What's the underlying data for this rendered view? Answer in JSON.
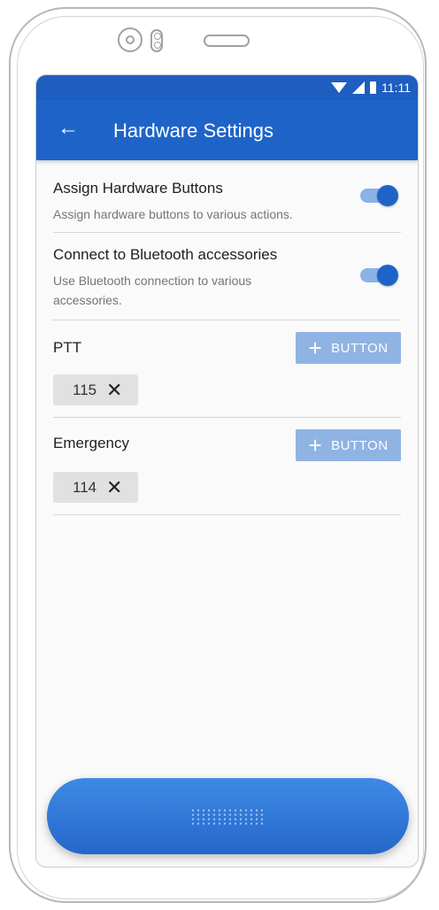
{
  "status_bar": {
    "time": "11:11"
  },
  "app_bar": {
    "back_glyph": "←",
    "title": "Hardware Settings"
  },
  "settings": [
    {
      "title": "Assign Hardware Buttons",
      "subtitle": "Assign hardware buttons to various actions.",
      "enabled": true
    },
    {
      "title": "Connect to Bluetooth accessories",
      "subtitle": "Use Bluetooth connection to various accessories.",
      "enabled": true
    }
  ],
  "button_groups": [
    {
      "label": "PTT",
      "add_label": "BUTTON",
      "chips": [
        {
          "value": "115"
        }
      ]
    },
    {
      "label": "Emergency",
      "add_label": "BUTTON",
      "chips": [
        {
          "value": "114"
        }
      ]
    }
  ],
  "icons": {
    "plus": "+",
    "remove": "✕"
  },
  "colors": {
    "primary": "#1e64c8",
    "status_bar": "#1e5ec1",
    "toggle_track": "#8ab2e6",
    "add_button": "#8fb3e2",
    "chip": "#e1e1e1"
  }
}
